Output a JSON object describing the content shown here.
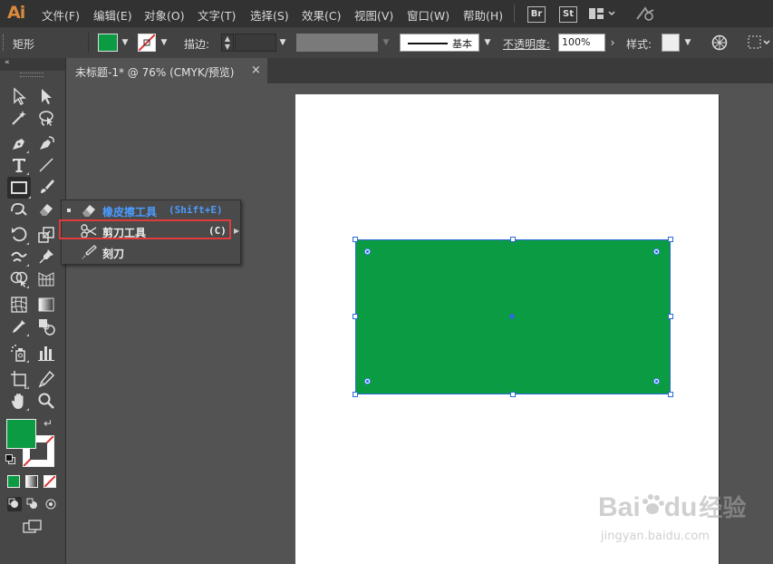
{
  "app": {
    "logo": "Ai"
  },
  "menubar": {
    "items": [
      "文件(F)",
      "编辑(E)",
      "对象(O)",
      "文字(T)",
      "选择(S)",
      "效果(C)",
      "视图(V)",
      "窗口(W)",
      "帮助(H)"
    ],
    "bridge": "Br",
    "stock": "St"
  },
  "controlbar": {
    "shape_label": "矩形",
    "stroke_label": "描边:",
    "brush_label": "基本",
    "opacity_label": "不透明度:",
    "opacity_value": "100%",
    "style_label": "样式:"
  },
  "document": {
    "tab_title": "未标题-1* @ 76% (CMYK/预览)",
    "close": "×"
  },
  "flyout": {
    "items": [
      {
        "label": "橡皮擦工具",
        "shortcut": "(Shift+E)",
        "active": true
      },
      {
        "label": "剪刀工具",
        "shortcut": "(C)",
        "highlighted": true
      },
      {
        "label": "刻刀",
        "shortcut": ""
      }
    ]
  },
  "colors": {
    "fill": "#0a9b43",
    "accent_blue": "#2a6bd6",
    "highlight_red": "#e03a3a"
  },
  "watermark": {
    "brand": "Bai",
    "brand2": "du",
    "cn": "经验",
    "url": "jingyan.baidu.com"
  }
}
